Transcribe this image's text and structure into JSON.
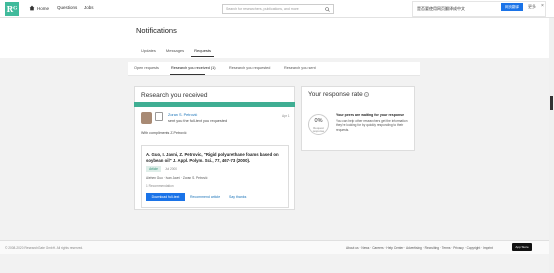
{
  "topbar": {
    "logo": "Rᴳ",
    "nav": [
      "Home",
      "Questions",
      "Jobs"
    ],
    "search_placeholder": "Search for researchers, publications, and more"
  },
  "translate_bar": {
    "text": "是否要使用网页翻译成中文",
    "translate_button": "网页翻译",
    "more": "更多",
    "close": "×"
  },
  "page": {
    "title": "Notifications",
    "tabs": [
      "Updates",
      "Messages",
      "Requests"
    ],
    "subtabs": [
      "Open requests",
      "Research you received (1)",
      "Research you requested",
      "Research you sent"
    ]
  },
  "received": {
    "title": "Research you received",
    "sender": "Zoran S. Petrović",
    "action": "sent you the full-text you requested",
    "date": "Apr 1",
    "message": "With compliments Z.Petrović",
    "article": {
      "title": "A. Guo, I. Javni, Z. Petrovic, \"Rigid polyurethane foams based on soybean oil\" J. Appl. Polym. Sci., 77, 467-73 (2000).",
      "type": "Article",
      "date": "Jul 2000",
      "authors": "Aiehen Guo · Ivan Javni · Zoran S. Petrović",
      "recommendations": "1 Recommendation"
    },
    "download_button": "Download full-text",
    "links": [
      "Recommend article",
      "Say thanks"
    ]
  },
  "response_rate": {
    "title": "Your response rate",
    "help": "?",
    "percent": "0%",
    "label": "Request response",
    "heading": "Your peers are waiting for your response",
    "text": "You can help other researchers get the information they're looking for by quickly responding to their requests."
  },
  "footer": {
    "copyright": "© 2008-2020 ResearchGate GmbH. All rights reserved.",
    "links": "About us · News · Careers · Help Center · Advertising · Recruiting · Terms · Privacy · Copyright · Imprint",
    "appstore": "App Store"
  },
  "colors": {
    "brand_green": "#40ba9b",
    "link_blue": "#1a73b8",
    "button_blue": "#1a73e8"
  }
}
